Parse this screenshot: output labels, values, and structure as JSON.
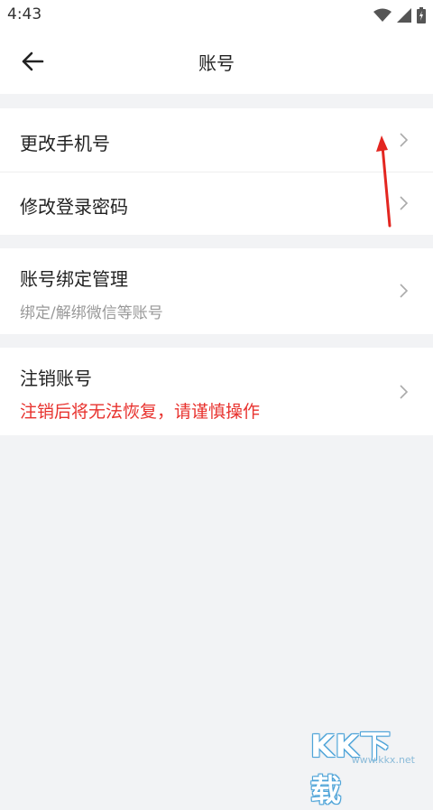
{
  "status_bar": {
    "time": "4:43",
    "icons": [
      "wifi-icon",
      "signal-icon",
      "battery-icon"
    ]
  },
  "header": {
    "title": "账号",
    "back_icon": "arrow-left-icon"
  },
  "groups": [
    {
      "items": [
        {
          "label": "更改手机号"
        },
        {
          "label": "修改登录密码"
        }
      ]
    },
    {
      "items": [
        {
          "label": "账号绑定管理",
          "subtitle": "绑定/解绑微信等账号"
        }
      ]
    },
    {
      "items": [
        {
          "label": "注销账号",
          "subtitle": "注销后将无法恢复，请谨慎操作"
        }
      ]
    }
  ],
  "annotation": {
    "arrow_color": "#e32620"
  },
  "watermark": {
    "logo": "KK下载",
    "url": "www.kkx.net"
  },
  "colors": {
    "background": "#f2f3f5",
    "card": "#ffffff",
    "text": "#222222",
    "subtext": "#999999",
    "warning": "#e8322e"
  }
}
